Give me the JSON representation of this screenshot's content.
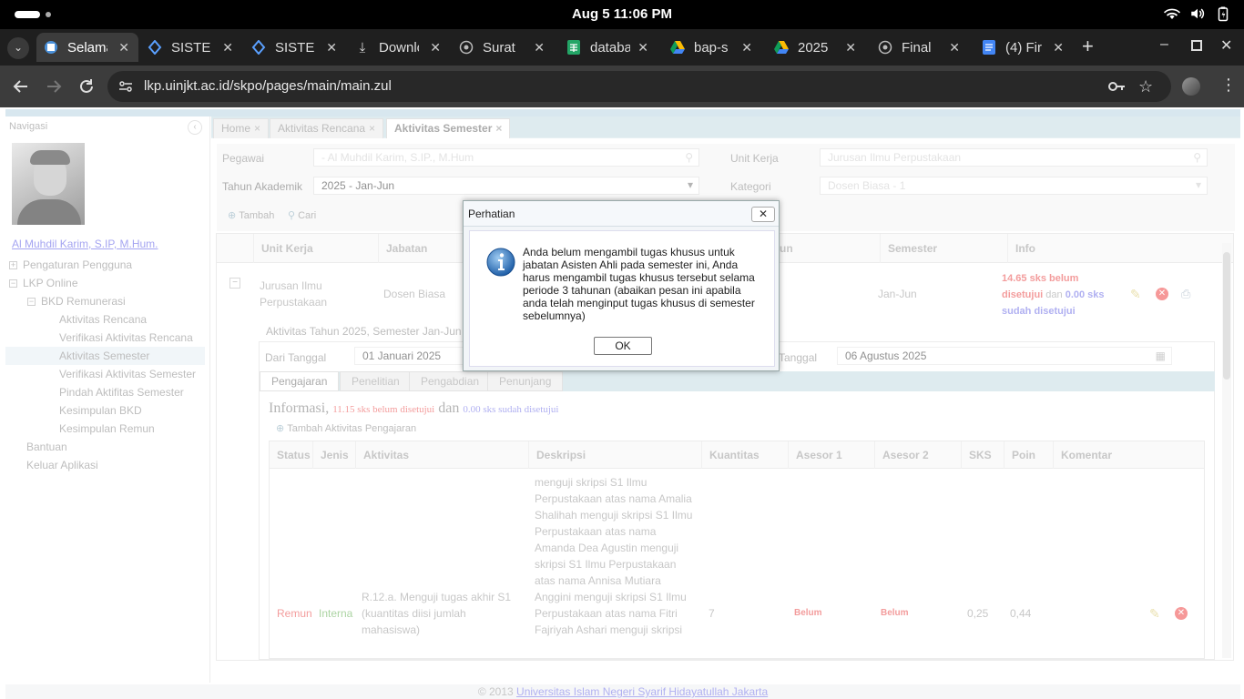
{
  "status_bar": {
    "clock": "Aug 5  11:06 PM"
  },
  "browser": {
    "tabs": [
      {
        "label": "Selamat",
        "icon": "uin-logo-icon",
        "active": true
      },
      {
        "label": "SISTEM",
        "icon": "sisteman-icon"
      },
      {
        "label": "SISTEM",
        "icon": "sisteman-icon"
      },
      {
        "label": "Download",
        "icon": "download-icon"
      },
      {
        "label": "Surat",
        "icon": "globe-icon"
      },
      {
        "label": "database",
        "icon": "sheets-icon"
      },
      {
        "label": "bap-s",
        "icon": "drive-icon"
      },
      {
        "label": "2025",
        "icon": "drive-icon"
      },
      {
        "label": "Final",
        "icon": "globe-icon"
      },
      {
        "label": "(4) Fir",
        "icon": "docs-icon"
      }
    ],
    "url": "lkp.uinjkt.ac.id/skpo/pages/main/main.zul"
  },
  "sidebar": {
    "title": "Navigasi",
    "user_name": "Al Muhdil Karim, S.IP, M.Hum.",
    "items": [
      {
        "label": "Pengaturan Pengguna"
      },
      {
        "label": "LKP Online"
      },
      {
        "label": "BKD Remunerasi"
      },
      {
        "label": "Aktivitas Rencana"
      },
      {
        "label": "Verifikasi Aktivitas Rencana"
      },
      {
        "label": "Aktivitas Semester"
      },
      {
        "label": "Verifikasi Aktivitas Semester"
      },
      {
        "label": "Pindah Aktifitas Semester"
      },
      {
        "label": "Kesimpulan BKD"
      },
      {
        "label": "Kesimpulan Remun"
      },
      {
        "label": "Bantuan"
      },
      {
        "label": "Keluar Aplikasi"
      }
    ]
  },
  "main": {
    "tabs": [
      "Home",
      "Aktivitas Rencana",
      "Aktivitas Semester"
    ],
    "form": {
      "pegawai_label": "Pegawai",
      "pegawai_value": "- Al Muhdil Karim, S.IP., M.Hum",
      "unit_label": "Unit Kerja",
      "unit_value": "Jurusan Ilmu Perpustakaan",
      "tahun_label": "Tahun Akademik",
      "tahun_value": "2025 - Jan-Jun",
      "kategori_label": "Kategori",
      "kategori_value": "Dosen Biasa - 1",
      "tambah": "Tambah",
      "cari": "Cari"
    },
    "grid": {
      "headers": [
        "Unit Kerja",
        "Jabatan",
        "un",
        "Semester",
        "Info"
      ],
      "row": {
        "unit": "Jurusan Ilmu Perpustakaan",
        "jabatan": "Dosen Biasa",
        "semester": "Jan-Jun",
        "info_red": "14.65 sks belum disetujui",
        "info_mid": "dan",
        "info_blue": "0.00 sks sudah disetujui"
      }
    },
    "sub": {
      "title": "Aktivitas Tahun 2025, Semester Jan-Jun",
      "dari_label": "Dari Tanggal",
      "dari_value": "01 Januari 2025",
      "sampai_label": "Tanggal",
      "sampai_value": "06 Agustus 2025",
      "tabs": [
        "Pengajaran",
        "Penelitian",
        "Pengabdian",
        "Penunjang"
      ],
      "info_label": "Informasi,",
      "info_red": "11.15 sks belum disetujui",
      "info_mid": "dan",
      "info_blue": "0.00 sks sudah disetujui",
      "tambah": "Tambah Aktivitas Pengajaran",
      "headers": [
        "Status",
        "Jenis",
        "Aktivitas",
        "Deskripsi",
        "Kuantitas",
        "Asesor 1",
        "Asesor 2",
        "SKS",
        "Poin",
        "Komentar"
      ],
      "row": {
        "status": "Remun",
        "jenis": "Interna",
        "aktivitas": "R.12.a. Menguji tugas akhir S1 (kuantitas diisi jumlah mahasiswa)",
        "deskripsi": "menguji skripsi S1 Ilmu Perpustakaan atas nama Amalia Shalihah menguji skripsi S1 Ilmu Perpustakaan atas nama Amanda Dea Agustin menguji skripsi S1 Ilmu Perpustakaan atas nama Annisa Mutiara Anggini menguji skripsi S1 Ilmu Perpustakaan atas nama Fitri Fajriyah Ashari menguji skripsi",
        "kuantitas": "7",
        "asesor1": "Belum",
        "asesor2": "Belum",
        "sks": "0,25",
        "poin": "0,44"
      }
    }
  },
  "dialog": {
    "title": "Perhatian",
    "message": "Anda belum mengambil tugas khusus untuk jabatan Asisten Ahli pada semester ini, Anda harus mengambil tugas khusus tersebut selama periode 3 tahunan (abaikan pesan ini apabila anda telah menginput tugas khusus di semester sebelumnya)",
    "ok": "OK"
  },
  "footer": {
    "copyright": "© 2013",
    "link": "Universitas Islam Negeri Syarif Hidayatullah Jakarta"
  }
}
